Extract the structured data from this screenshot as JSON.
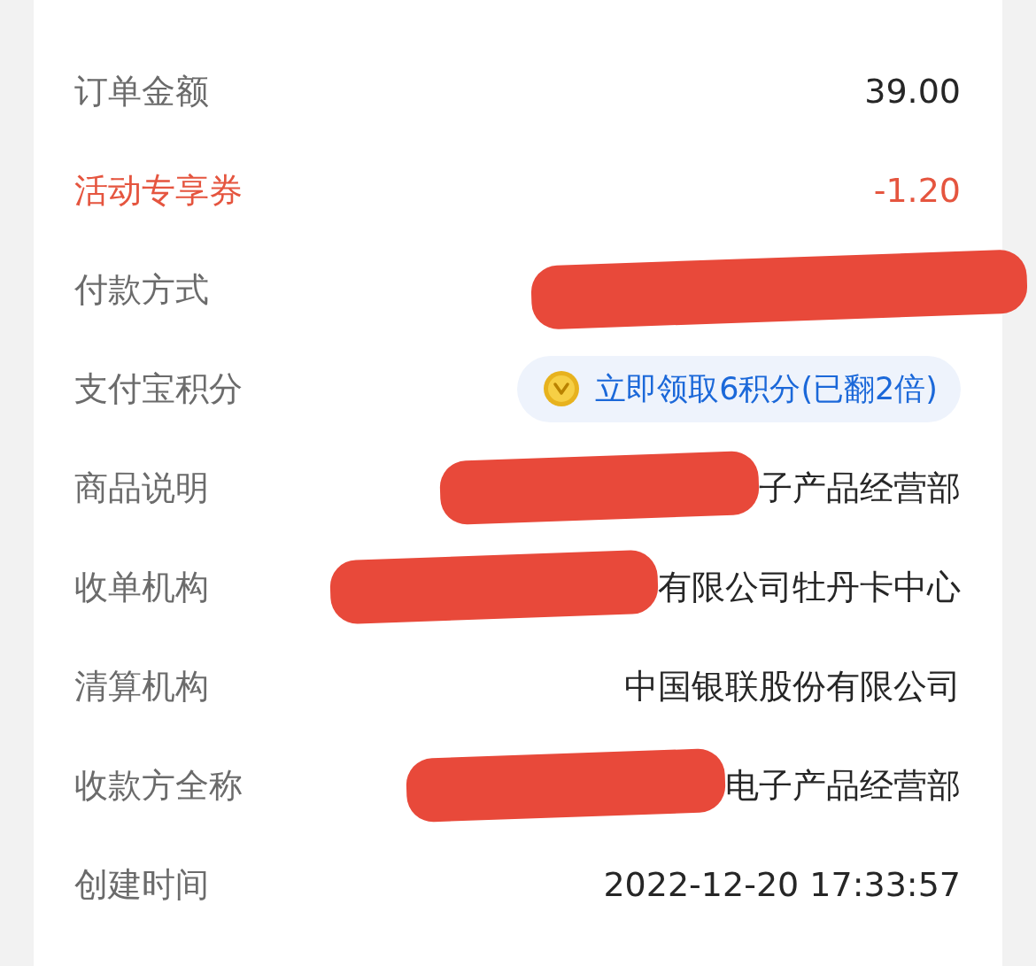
{
  "rows": [
    {
      "kind": "plain",
      "label": "订单金额",
      "value": "39.00"
    },
    {
      "kind": "red",
      "label": "活动专享券",
      "value": "-1.20"
    },
    {
      "kind": "plain",
      "label": "付款方式",
      "redacted": true
    },
    {
      "kind": "points",
      "label": "支付宝积分",
      "value": "立即领取6积分(已翻2倍)"
    },
    {
      "kind": "plain",
      "label": "商品说明",
      "value": "子产品经营部",
      "redacted": true
    },
    {
      "kind": "plain",
      "label": "收单机构",
      "value": "有限公司牡丹卡中心",
      "redacted": true
    },
    {
      "kind": "plain",
      "label": "清算机构",
      "value": "中国银联股份有限公司"
    },
    {
      "kind": "plain",
      "label": "收款方全称",
      "value": "电子产品经营部",
      "redacted": true
    },
    {
      "kind": "plain",
      "label": "创建时间",
      "value": "2022-12-20 17:33:57"
    }
  ]
}
